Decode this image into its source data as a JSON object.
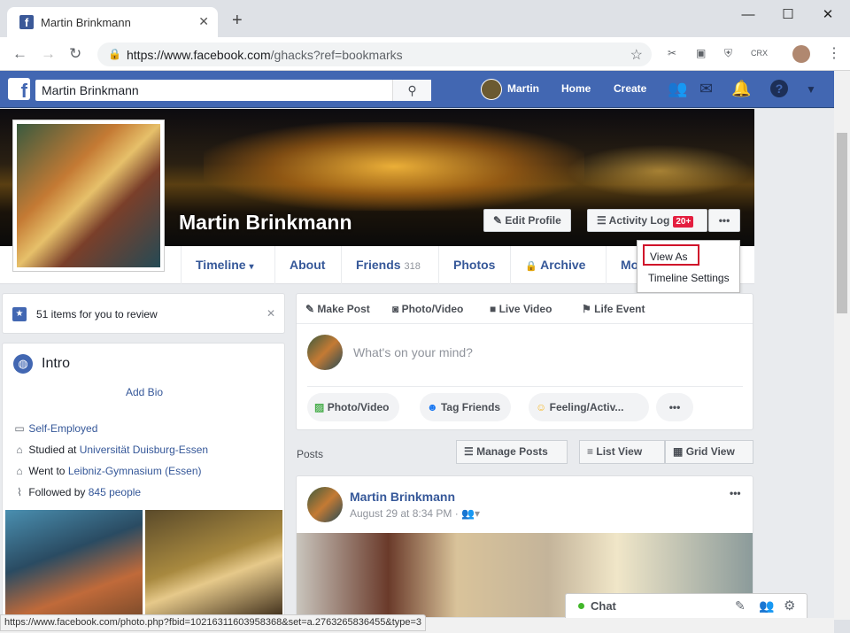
{
  "browser": {
    "tab_title": "Martin Brinkmann",
    "tab_close": "✕",
    "new_tab": "+",
    "url_host": "https://www.facebook.com",
    "url_path": "/ghacks?ref=bookmarks",
    "window_controls": [
      "—",
      "☐",
      "✕"
    ],
    "status_url": "https://www.facebook.com/photo.php?fbid=10216311603958368&set=a.2763265836455&type=3"
  },
  "fb_header": {
    "logo": "f",
    "search_value": "Martin Brinkmann",
    "user_name": "Martin",
    "home": "Home",
    "create": "Create"
  },
  "profile": {
    "name": "Martin Brinkmann",
    "edit_profile": "Edit Profile",
    "activity_log": "Activity Log",
    "activity_badge": "20+",
    "more_dots": "•••",
    "tabs": [
      {
        "label": "Timeline",
        "extra": "▾"
      },
      {
        "label": "About"
      },
      {
        "label": "Friends",
        "count": "318"
      },
      {
        "label": "Photos"
      },
      {
        "label": "Archive"
      },
      {
        "label": "Mo"
      }
    ]
  },
  "menu": {
    "view_as": "View As",
    "timeline_settings": "Timeline Settings"
  },
  "review": {
    "text": "51 items for you to review",
    "close": "✕"
  },
  "intro": {
    "title": "Intro",
    "add_bio": "Add Bio",
    "items": [
      {
        "prefix": "",
        "link": "Self-Employed"
      },
      {
        "prefix": "Studied at ",
        "link": "Universität Duisburg-Essen"
      },
      {
        "prefix": "Went to ",
        "link": "Leibniz-Gymnasium (Essen)"
      },
      {
        "prefix": "Followed by ",
        "link": "845 people"
      }
    ]
  },
  "composer": {
    "tabs": [
      "Make Post",
      "Photo/Video",
      "Live Video",
      "Life Event"
    ],
    "placeholder": "What's on your mind?",
    "pills": [
      "Photo/Video",
      "Tag Friends",
      "Feeling/Activ..."
    ],
    "more": "•••"
  },
  "posts_bar": {
    "label": "Posts",
    "manage": "Manage Posts",
    "list_view": "List View",
    "grid_view": "Grid View"
  },
  "post": {
    "author": "Martin Brinkmann",
    "date": "August 29 at 8:34 PM",
    "more": "•••"
  },
  "chat": {
    "label": "Chat"
  },
  "colors": {
    "fb_blue": "#4267b2",
    "link": "#365899",
    "badge_red": "#e41e3f",
    "online": "#42b72a"
  }
}
